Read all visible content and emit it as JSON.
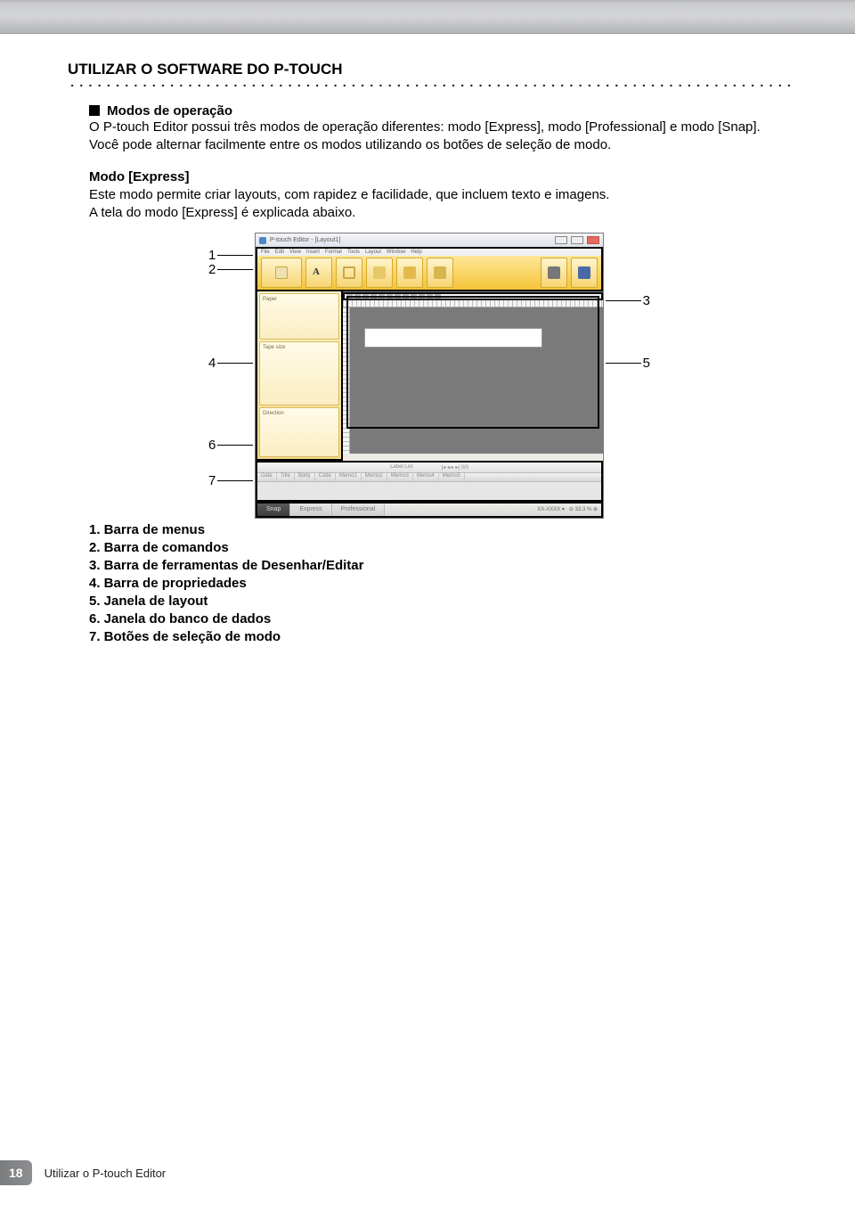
{
  "header": {
    "title": "UTILIZAR O SOFTWARE DO P-TOUCH"
  },
  "intro": {
    "heading": "Modos de operação",
    "text": "O P-touch Editor possui três modos de operação diferentes: modo [Express], modo [Professional] e modo [Snap]. Você pode alternar facilmente entre os modos utilizando os botões de seleção de modo."
  },
  "express": {
    "heading": "Modo [Express]",
    "line1": "Este modo permite criar layouts, com rapidez e facilidade, que incluem texto e imagens.",
    "line2": "A tela do modo [Express] é explicada abaixo."
  },
  "screenshot": {
    "title": "P-touch Editor - [Layout1]",
    "menus": [
      "File",
      "Edit",
      "View",
      "Insert",
      "Format",
      "Tools",
      "Layout",
      "Window",
      "Help"
    ],
    "mode_tabs": {
      "snap": "Snap",
      "express": "Express",
      "professional": "Professional"
    },
    "zoom": "33.3 %"
  },
  "callouts": {
    "n1": "1",
    "n2": "2",
    "n3": "3",
    "n4": "4",
    "n5": "5",
    "n6": "6",
    "n7": "7"
  },
  "legend": [
    "1.  Barra de menus",
    "2.  Barra de comandos",
    "3.  Barra de ferramentas de Desenhar/Editar",
    "4.  Barra de propriedades",
    "5.  Janela de layout",
    "6.  Janela do banco de dados",
    "7.  Botões de seleção de modo"
  ],
  "footer": {
    "page_number": "18",
    "breadcrumb": "Utilizar o P-touch Editor"
  }
}
